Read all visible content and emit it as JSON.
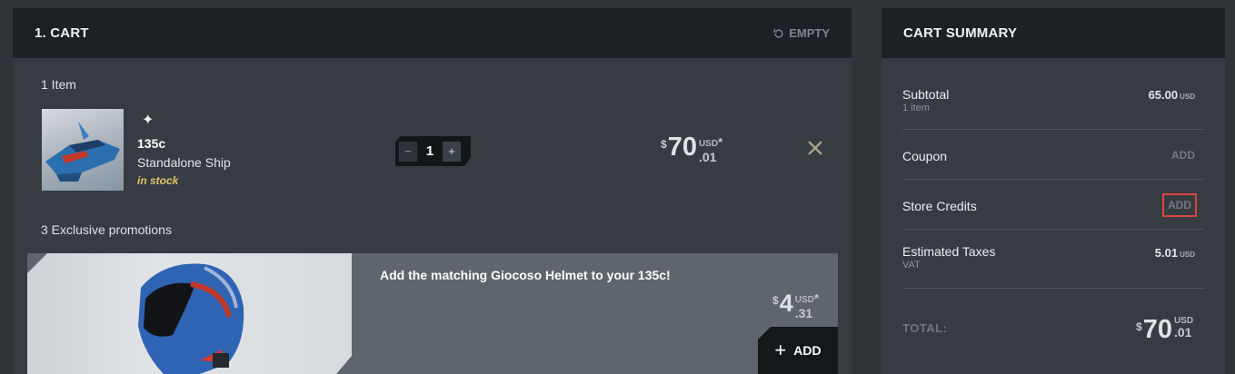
{
  "cart": {
    "title": "1. CART",
    "empty_label": "EMPTY",
    "count_label": "1 Item",
    "item": {
      "type_icon": "ship-type-icon",
      "name": "135c",
      "description": "Standalone Ship",
      "stock": "in stock",
      "quantity": "1",
      "qty_minus": "−",
      "qty_plus": "+",
      "price": {
        "currency": "$",
        "int": "70",
        "unit": "USD",
        "dec": ".01",
        "star": "*"
      }
    },
    "promotions_label": "3 Exclusive promotions",
    "promotion": {
      "title": "Add the matching Giocoso Helmet to your 135c!",
      "price": {
        "currency": "$",
        "int": "4",
        "unit": "USD",
        "dec": ".31",
        "star": "*"
      },
      "add_label": "ADD",
      "add_icon": "+"
    }
  },
  "summary": {
    "title": "CART SUMMARY",
    "subtotal": {
      "label": "Subtotal",
      "sub": "1 item",
      "value": "65.00",
      "unit": "USD"
    },
    "coupon": {
      "label": "Coupon",
      "action": "ADD"
    },
    "store_credits": {
      "label": "Store Credits",
      "action": "ADD"
    },
    "taxes": {
      "label": "Estimated Taxes",
      "sub": "VAT",
      "value": "5.01",
      "unit": "USD"
    },
    "total": {
      "label": "TOTAL:",
      "currency": "$",
      "int": "70",
      "unit": "USD",
      "dec": ".01"
    }
  },
  "colors": {
    "highlight": "#d9453f",
    "stock": "#e3c46a"
  }
}
